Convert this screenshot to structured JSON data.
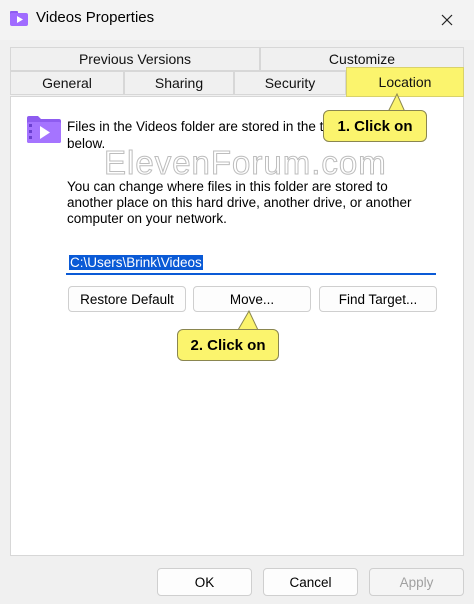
{
  "window": {
    "title": "Videos Properties"
  },
  "tabs": {
    "row1": [
      "Previous Versions",
      "Customize"
    ],
    "row2": [
      "General",
      "Sharing",
      "Security",
      "Location"
    ]
  },
  "location": {
    "line1": "Files in the Videos folder are stored in the tar",
    "line2": "below.",
    "desc": "You can change where files in this folder are stored to another place on this hard drive, another drive, or another computer on your network.",
    "path": "C:\\Users\\Brink\\Videos",
    "restore_label": "Restore Default",
    "move_label": "Move...",
    "find_label": "Find Target..."
  },
  "footer": {
    "ok": "OK",
    "cancel": "Cancel",
    "apply": "Apply"
  },
  "callouts": {
    "one": "1. Click on",
    "two": "2. Click on"
  },
  "watermark": "ElevenForum.com",
  "colors": {
    "highlight": "#fbf46d",
    "selection": "#0a5ad6"
  },
  "icons": {
    "title": "video-folder-icon",
    "close": "close-icon"
  }
}
